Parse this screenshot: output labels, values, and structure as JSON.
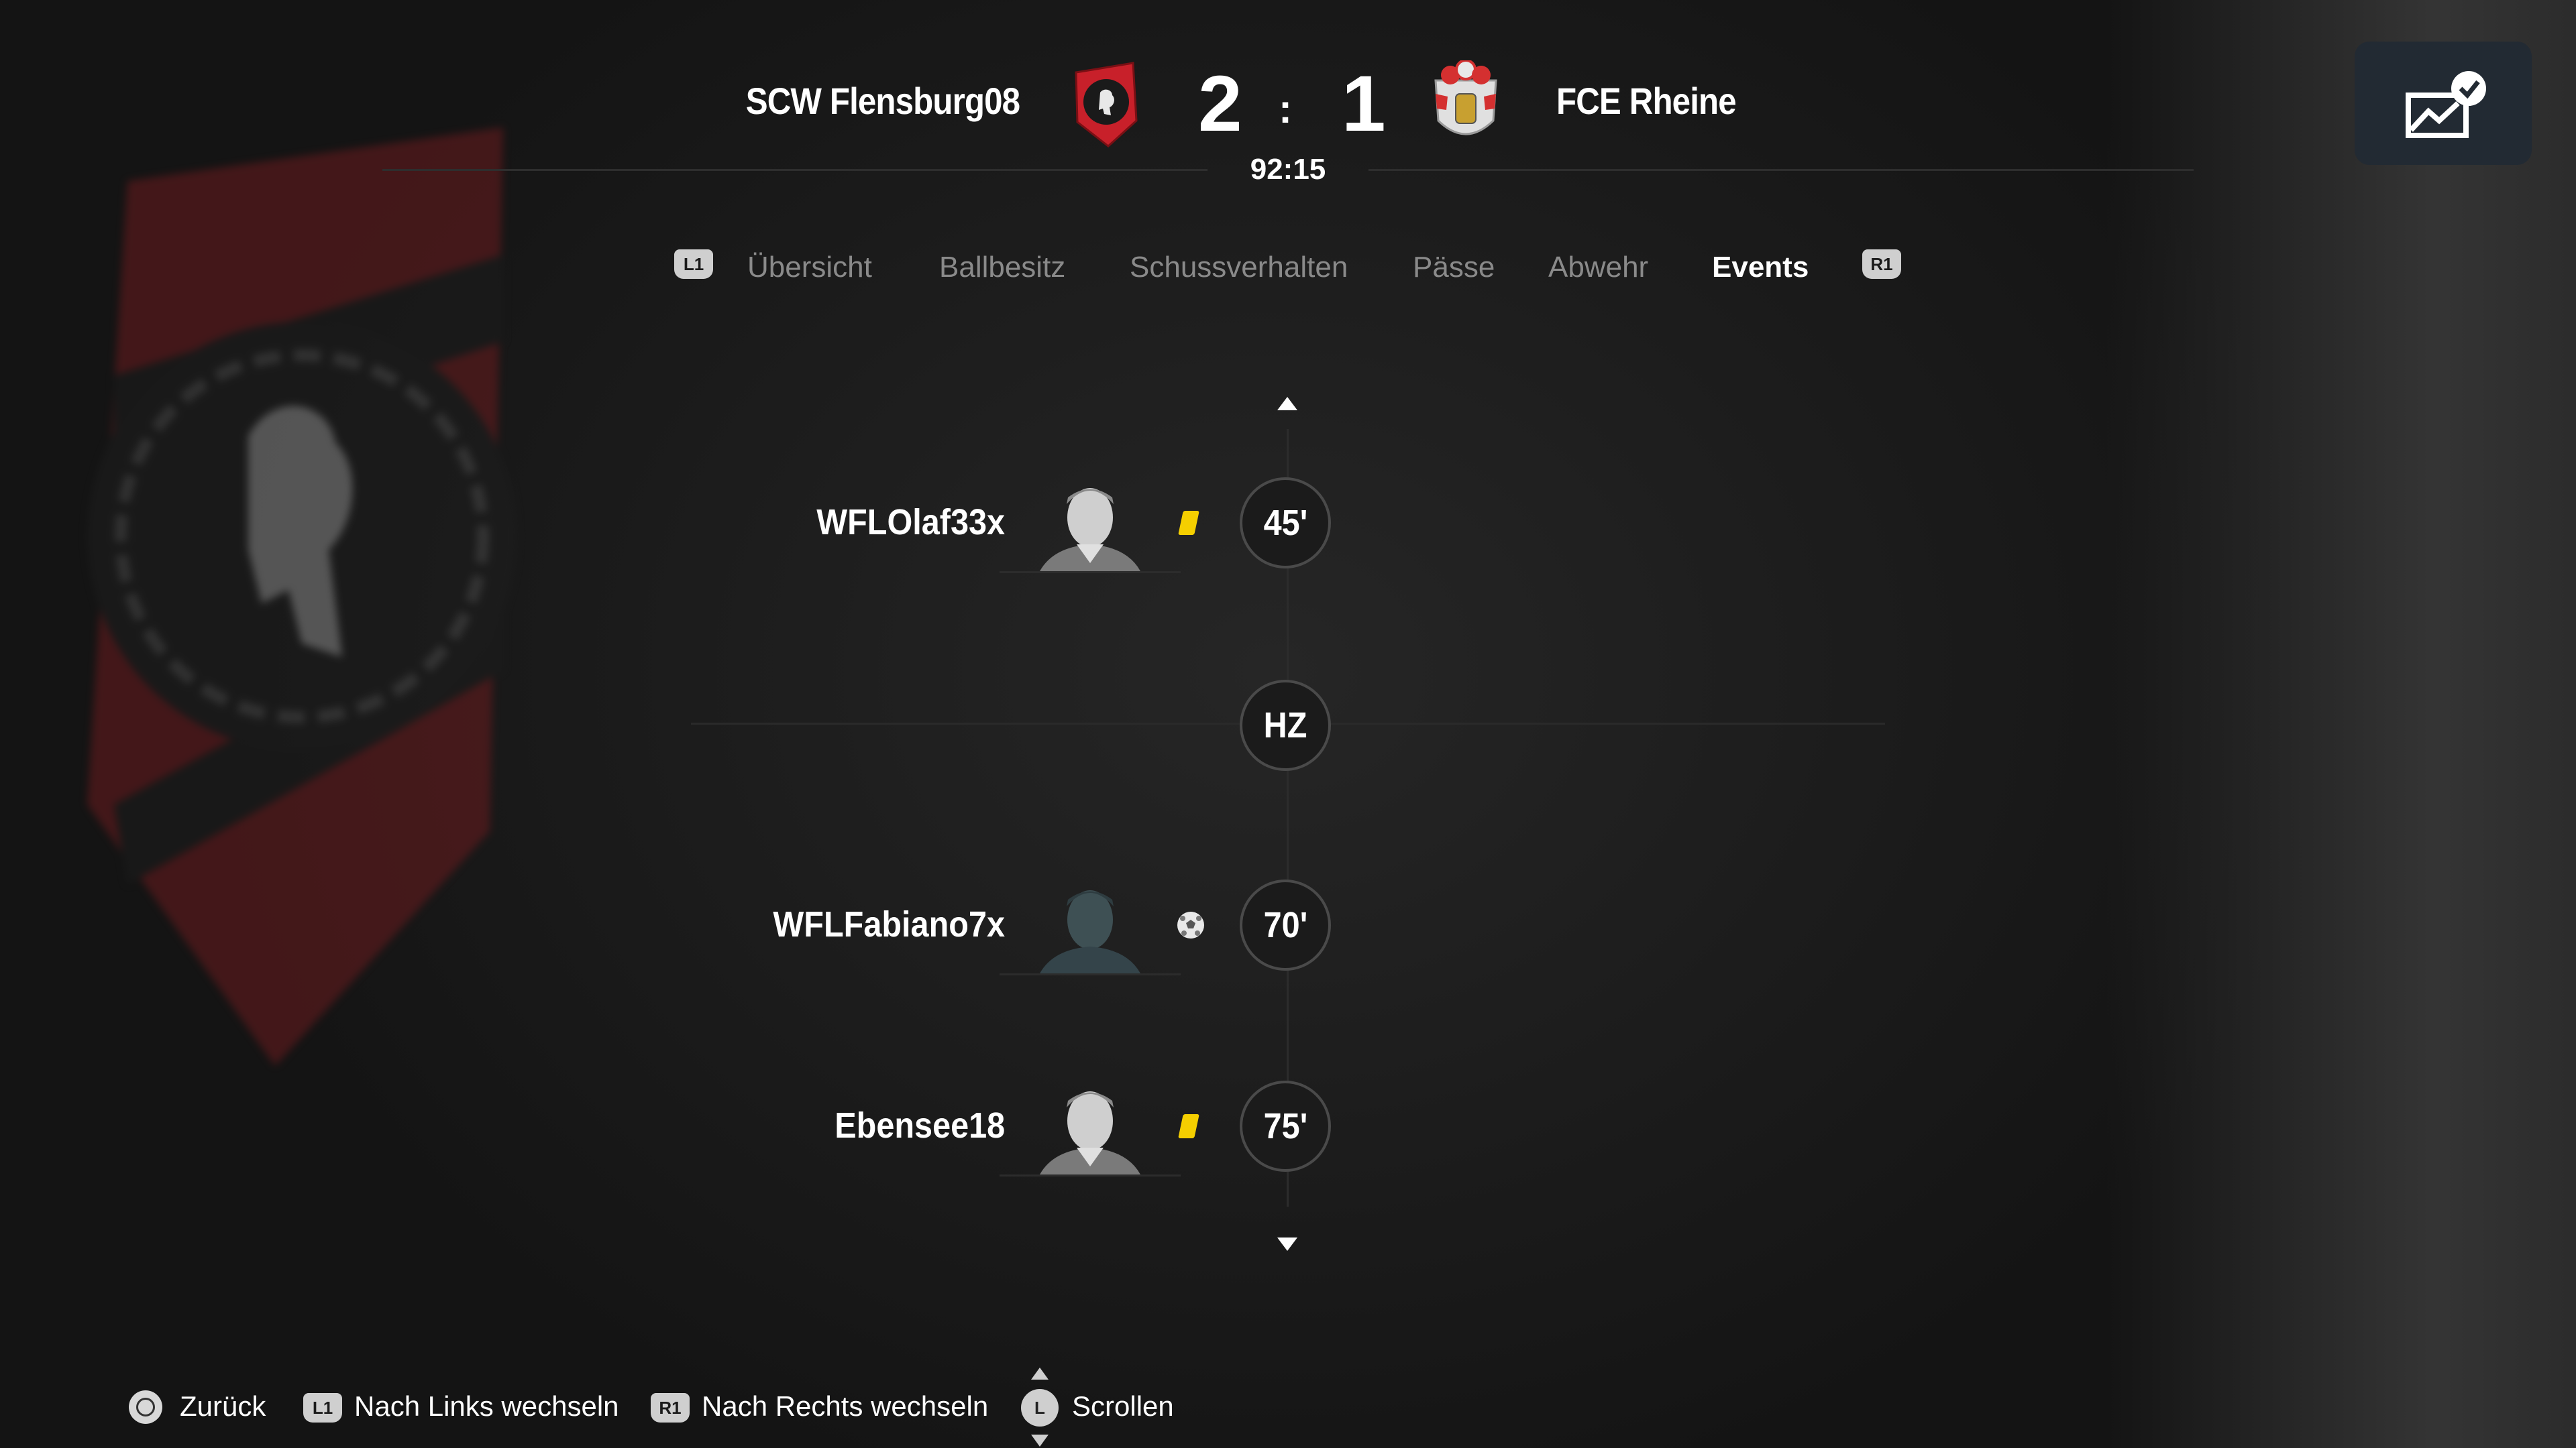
{
  "header": {
    "home_team": "SCW Flensburg08",
    "away_team": "FCE Rheine",
    "home_score": "2",
    "away_score": "1",
    "score_separator": ":",
    "match_clock": "92:15"
  },
  "tabs": {
    "left_hint": "L1",
    "right_hint": "R1",
    "items": [
      "Übersicht",
      "Ballbesitz",
      "Schussverhalten",
      "Pässe",
      "Abwehr",
      "Events"
    ],
    "active": "Events"
  },
  "events": [
    {
      "player": "WFLOlaf33x",
      "type": "yellow-card",
      "minute": "45'"
    },
    {
      "divider": "HZ"
    },
    {
      "player": "WFLFabiano7x",
      "type": "goal",
      "minute": "70'"
    },
    {
      "player": "Ebensee18",
      "type": "yellow-card",
      "minute": "75'"
    }
  ],
  "footer": {
    "back": "Zurück",
    "left_button": "L1",
    "left": "Nach Links wechseln",
    "right_button": "R1",
    "right": "Nach Rechts wechseln",
    "scroll_button": "L",
    "scroll": "Scrollen"
  },
  "colors": {
    "background": "#1a1a1a",
    "home_red": "#c8202a",
    "yellow_card": "#f5cf00",
    "stats_button": "#222a33"
  }
}
